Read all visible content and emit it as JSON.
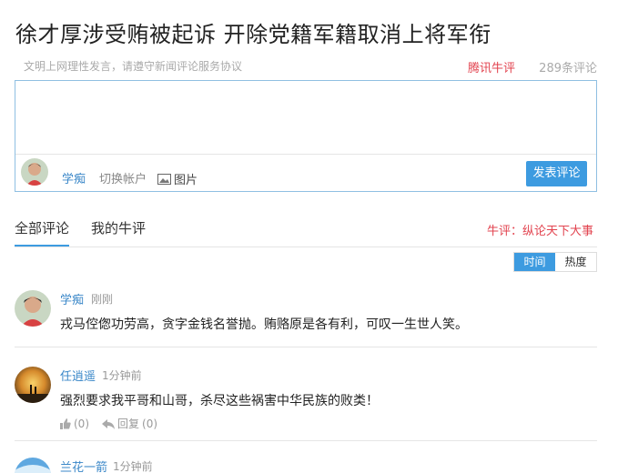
{
  "article": {
    "title": "徐才厚涉受贿被起诉 开除党籍军籍取消上将军衔"
  },
  "subbar": {
    "rules": "文明上网理性发言，请遵守新闻评论服务协议",
    "brand": "腾讯牛评",
    "count": "289条评论"
  },
  "editor": {
    "placeholder": "",
    "user": "学痴",
    "switch_account": "切换帐户",
    "picture": "图片",
    "post_button": "发表评论"
  },
  "tabs": {
    "all": "全部评论",
    "mine": "我的牛评",
    "slogan": "牛评：纵论天下大事"
  },
  "sort": {
    "time": "时间",
    "hot": "热度"
  },
  "comments": [
    {
      "name": "学痴",
      "time": "刚刚",
      "text": "戎马倥偬功劳高，贪字金钱名誉抛。贿赂原是各有利，可叹一生世人笑。"
    },
    {
      "name": "任逍遥",
      "time": "1分钟前",
      "text": "强烈要求我平哥和山哥，杀尽这些祸害中华民族的败类！",
      "likes": "(0)",
      "reply": "回复",
      "replies": "(0)"
    },
    {
      "name": "兰花一箭",
      "time": "1分钟前"
    }
  ]
}
